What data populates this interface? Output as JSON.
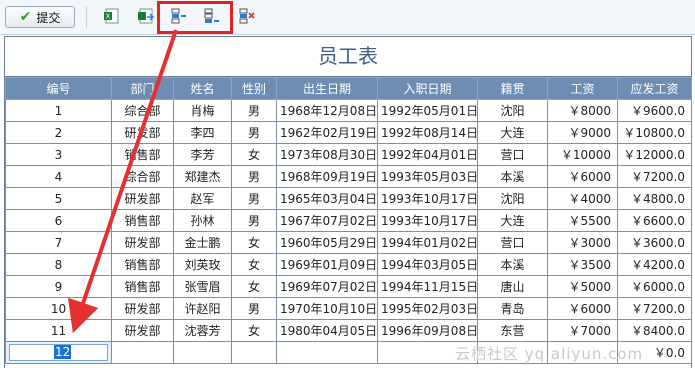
{
  "toolbar": {
    "submit_label": "提交",
    "icons": [
      "excel-import-icon",
      "excel-export-icon",
      "insert-row-icon",
      "append-row-icon",
      "delete-row-icon"
    ]
  },
  "table": {
    "title": "员工表",
    "columns": [
      "编号",
      "部门",
      "姓名",
      "性别",
      "出生日期",
      "入职日期",
      "籍贯",
      "工资",
      "应发工资"
    ],
    "rows": [
      [
        "1",
        "综合部",
        "肖梅",
        "男",
        "1968年12月08日",
        "1992年05月01日",
        "沈阳",
        "￥8000",
        "￥9600.0"
      ],
      [
        "2",
        "研发部",
        "李四",
        "男",
        "1962年02月19日",
        "1992年08月14日",
        "大连",
        "￥9000",
        "￥10800.0"
      ],
      [
        "3",
        "销售部",
        "李芳",
        "女",
        "1973年08月30日",
        "1992年04月01日",
        "营口",
        "￥10000",
        "￥12000.0"
      ],
      [
        "4",
        "综合部",
        "郑建杰",
        "男",
        "1968年09月19日",
        "1993年05月03日",
        "本溪",
        "￥6000",
        "￥7200.0"
      ],
      [
        "5",
        "研发部",
        "赵军",
        "男",
        "1965年03月04日",
        "1993年10月17日",
        "沈阳",
        "￥4000",
        "￥4800.0"
      ],
      [
        "6",
        "销售部",
        "孙林",
        "男",
        "1967年07月02日",
        "1993年10月17日",
        "大连",
        "￥5500",
        "￥6600.0"
      ],
      [
        "7",
        "研发部",
        "金士鹏",
        "女",
        "1960年05月29日",
        "1994年01月02日",
        "营口",
        "￥3000",
        "￥3600.0"
      ],
      [
        "8",
        "销售部",
        "刘英玫",
        "女",
        "1969年01月09日",
        "1994年03月05日",
        "本溪",
        "￥3500",
        "￥4200.0"
      ],
      [
        "9",
        "销售部",
        "张雪眉",
        "女",
        "1969年07月02日",
        "1994年11月15日",
        "唐山",
        "￥5000",
        "￥6000.0"
      ],
      [
        "10",
        "研发部",
        "许赵阳",
        "男",
        "1970年10月10日",
        "1995年02月03日",
        "青岛",
        "￥6000",
        "￥7200.0"
      ],
      [
        "11",
        "研发部",
        "沈蓉芳",
        "女",
        "1980年04月05日",
        "1996年09月08日",
        "东营",
        "￥7000",
        "￥8400.0"
      ]
    ],
    "new_row": {
      "id": "12",
      "salary_due": "￥0.0"
    }
  },
  "watermark": "云栖社区 yq.aliyun.com",
  "colors": {
    "header_bg": "#6d8db3",
    "title": "#3f5f84",
    "highlight": "#e02424"
  }
}
